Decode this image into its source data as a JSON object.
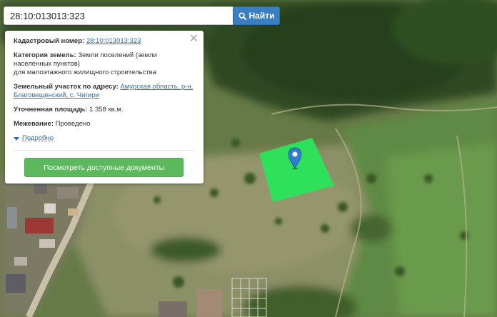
{
  "search": {
    "value": "28:10:013013:323",
    "button_label": "Найти"
  },
  "info_card": {
    "cadastral_label": "Кадастровый номер:",
    "cadastral_value": "28:10:013013:323",
    "category_label": "Категория земель:",
    "category_value_line1": " Земли поселений (земли",
    "category_value_line2": "населенных пунктов)",
    "category_value_line3": "для малоэтажного жилищного строительства",
    "address_label": "Земельный участок по адресу:",
    "address_value_line1": "Амурская область, р-н.",
    "address_value_line2": "Благовещенский, с. Чигири",
    "area_label": "Уточненная площадь:",
    "area_value": " 1 358 кв.м.",
    "survey_label": "Межевание:",
    "survey_value": " Проведено",
    "details_link": "Подробно",
    "docs_button": "Посмотреть доступные документы"
  },
  "map": {
    "parcel_color": "#2fe05a",
    "marker_color": "#2f7fd0"
  },
  "icons": {
    "search": "search-icon",
    "close": "close-icon",
    "marker": "map-marker-icon",
    "expand": "caret-down-icon"
  }
}
